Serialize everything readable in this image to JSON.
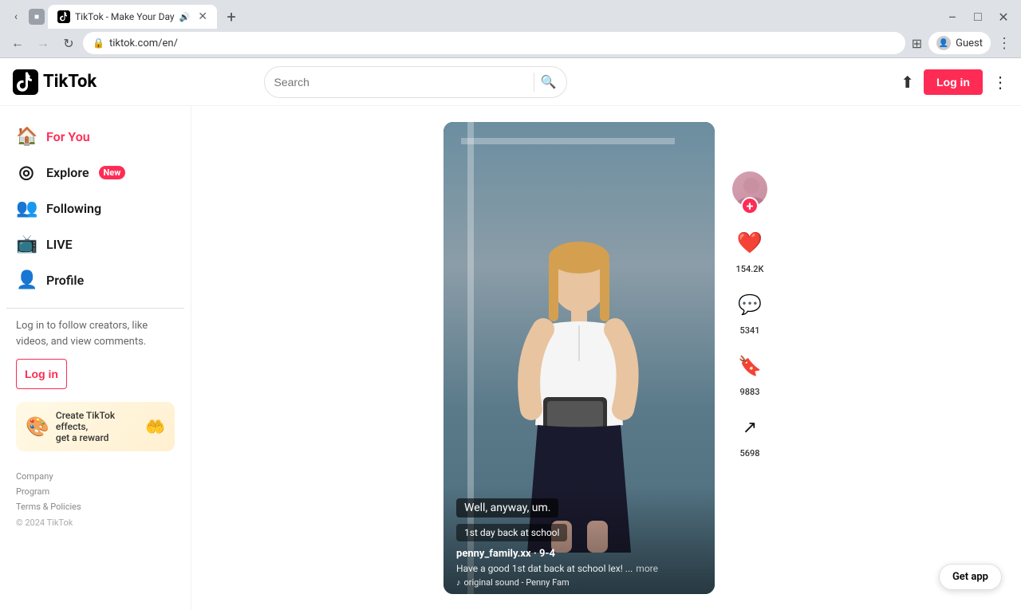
{
  "browser": {
    "tab_title": "TikTok - Make Your Day",
    "tab_favicon": "T",
    "url": "tiktok.com/en/",
    "profile_label": "Guest"
  },
  "header": {
    "logo_text": "TikTok",
    "search_placeholder": "Search",
    "login_label": "Log in"
  },
  "sidebar": {
    "nav_items": [
      {
        "id": "for-you",
        "label": "For You",
        "icon": "🏠",
        "active": true
      },
      {
        "id": "explore",
        "label": "Explore",
        "icon": "◎",
        "active": false,
        "badge": "New"
      },
      {
        "id": "following",
        "label": "Following",
        "icon": "👥",
        "active": false
      },
      {
        "id": "live",
        "label": "LIVE",
        "icon": "📺",
        "active": false
      },
      {
        "id": "profile",
        "label": "Profile",
        "icon": "👤",
        "active": false
      }
    ],
    "cta_text": "Log in to follow creators, like videos, and view comments.",
    "login_label": "Log in",
    "effects_banner_line1": "Create TikTok effects,",
    "effects_banner_line2": "get a reward",
    "footer_links": [
      "Company",
      "Program",
      "Terms & Policies"
    ],
    "copyright": "© 2024 TikTok"
  },
  "video": {
    "subtitle_text": "Well, anyway, um.",
    "tag_text": "1st day back at school",
    "author": "penny_family.xx · 9-4",
    "description": "Have a good 1st dat back at school lex! ...",
    "more_label": "more",
    "sound": "original sound - Penny Fam",
    "likes": "154.2K",
    "comments": "5341",
    "bookmarks": "9883",
    "shares": "5698"
  },
  "colors": {
    "primary": "#fe2c55",
    "like_icon": "#fe2c55",
    "heart_color": "#ffffff"
  }
}
